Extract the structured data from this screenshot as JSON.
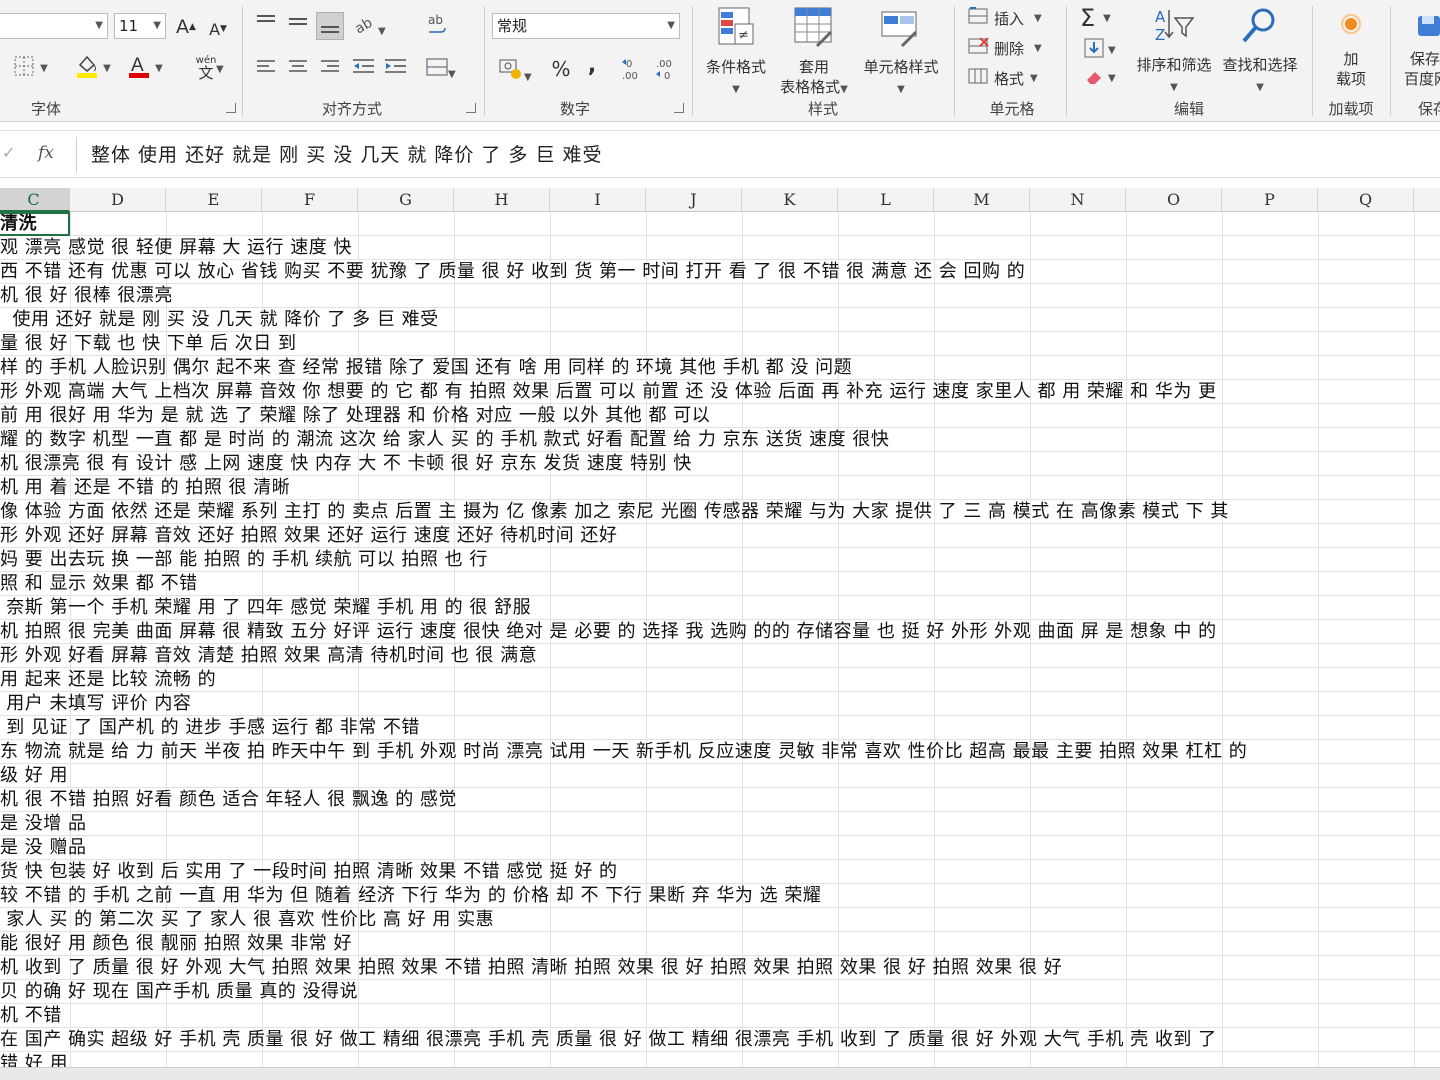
{
  "ribbon": {
    "font_group": {
      "font_size": "11",
      "grow_font": "A",
      "shrink_font": "A",
      "wen_label": "wén",
      "wen_char": "文",
      "label": "字体"
    },
    "align_group": {
      "label": "对齐方式"
    },
    "number_group": {
      "format_value": "常规",
      "percent": "%",
      "comma": ",",
      "label": "数字"
    },
    "styles_group": {
      "conditional_format": "条件格式",
      "table_format_line1": "套用",
      "table_format_line2": "表格格式",
      "cell_styles": "单元格样式",
      "label": "样式"
    },
    "cells_group": {
      "insert": "插入",
      "delete": "删除",
      "format": "格式",
      "label": "单元格"
    },
    "editing_group": {
      "sum": "Σ",
      "sort_filter": "排序和筛选",
      "find_select": "查找和选择",
      "label": "编辑"
    },
    "addins_group": {
      "addins_line1": "加",
      "addins_line2": "载项",
      "label": "加载项"
    },
    "save_group": {
      "save_line1": "保存",
      "save_line2": "百度网",
      "label": "保存"
    }
  },
  "formula_bar": {
    "fx": "fx",
    "value": "整体 使用 还好 就是 刚 买 没 几天 就 降价 了 多 巨 难受"
  },
  "columns": [
    "C",
    "D",
    "E",
    "F",
    "G",
    "H",
    "I",
    "J",
    "K",
    "L",
    "M",
    "N",
    "O",
    "P",
    "Q"
  ],
  "rows": [
    "清洗",
    "观 漂亮 感觉 很 轻便 屏幕 大 运行 速度 快",
    "西 不错 还有 优惠 可以 放心 省钱 购买 不要 犹豫 了 质量 很 好 收到 货 第一 时间 打开 看 了 很 不错 很 满意 还 会 回购 的",
    "机 很 好 很棒 很漂亮",
    "  使用 还好 就是 刚 买 没 几天 就 降价 了 多 巨 难受",
    "量 很 好 下载 也 快 下单 后 次日 到",
    "样 的 手机 人脸识别 偶尔 起不来 查 经常 报错 除了 爱国 还有 啥 用 同样 的 环境 其他 手机 都 没 问题",
    "形 外观 高端 大气 上档次 屏幕 音效 你 想要 的 它 都 有 拍照 效果 后置 可以 前置 还 没 体验 后面 再 补充 运行 速度 家里人 都 用 荣耀 和 华为 更",
    "前 用 很好 用 华为 是 就 选 了 荣耀 除了 处理器 和 价格 对应 一般 以外 其他 都 可以",
    "耀 的 数字 机型 一直 都 是 时尚 的 潮流 这次 给 家人 买 的 手机 款式 好看 配置 给 力 京东 送货 速度 很快",
    "机 很漂亮 很 有 设计 感 上网 速度 快 内存 大 不 卡顿 很 好 京东 发货 速度 特别 快",
    "机 用 着 还是 不错 的 拍照 很 清晰",
    "像 体验 方面 依然 还是 荣耀 系列 主打 的 卖点 后置 主 摄为 亿 像素 加之 索尼 光圈 传感器 荣耀 与为 大家 提供 了 三 高 模式 在 高像素 模式 下 其",
    "形 外观 还好 屏幕 音效 还好 拍照 效果 还好 运行 速度 还好 待机时间 还好",
    "妈 要 出去玩 换 一部 能 拍照 的 手机 续航 可以 拍照 也 行",
    "照 和 显示 效果 都 不错",
    " 奈斯 第一个 手机 荣耀 用 了 四年 感觉 荣耀 手机 用 的 很 舒服",
    "机 拍照 很 完美 曲面 屏幕 很 精致 五分 好评 运行 速度 很快 绝对 是 必要 的 选择 我 选购 的的 存储容量 也 挺 好 外形 外观 曲面 屏 是 想象 中 的",
    "形 外观 好看 屏幕 音效 清楚 拍照 效果 高清 待机时间 也 很 满意",
    "用 起来 还是 比较 流畅 的",
    " 用户 未填写 评价 内容",
    " 到 见证 了 国产机 的 进步 手感 运行 都 非常 不错",
    "东 物流 就是 给 力 前天 半夜 拍 昨天中午 到 手机 外观 时尚 漂亮 试用 一天 新手机 反应速度 灵敏 非常 喜欢 性价比 超高 最最 主要 拍照 效果 杠杠 的",
    "级 好 用",
    "机 很 不错 拍照 好看 颜色 适合 年轻人 很 飘逸 的 感觉",
    "是 没增 品",
    "是 没 赠品",
    "货 快 包装 好 收到 后 实用 了 一段时间 拍照 清晰 效果 不错 感觉 挺 好 的",
    "较 不错 的 手机 之前 一直 用 华为 但 随着 经济 下行 华为 的 价格 却 不 下行 果断 弃 华为 选 荣耀",
    " 家人 买 的 第二次 买 了 家人 很 喜欢 性价比 高 好 用 实惠",
    "能 很好 用 颜色 很 靓丽 拍照 效果 非常 好",
    "机 收到 了 质量 很 好 外观 大气 拍照 效果 拍照 效果 不错 拍照 清晰 拍照 效果 很 好 拍照 效果 拍照 效果 很 好 拍照 效果 很 好",
    "贝 的确 好 现在 国产手机 质量 真的 没得说",
    "机 不错",
    "在 国产 确实 超级 好 手机 壳 质量 很 好 做工 精细 很漂亮 手机 壳 质量 很 好 做工 精细 很漂亮 手机 收到 了 质量 很 好 外观 大气 手机 壳 收到 了",
    "错 好 用"
  ]
}
